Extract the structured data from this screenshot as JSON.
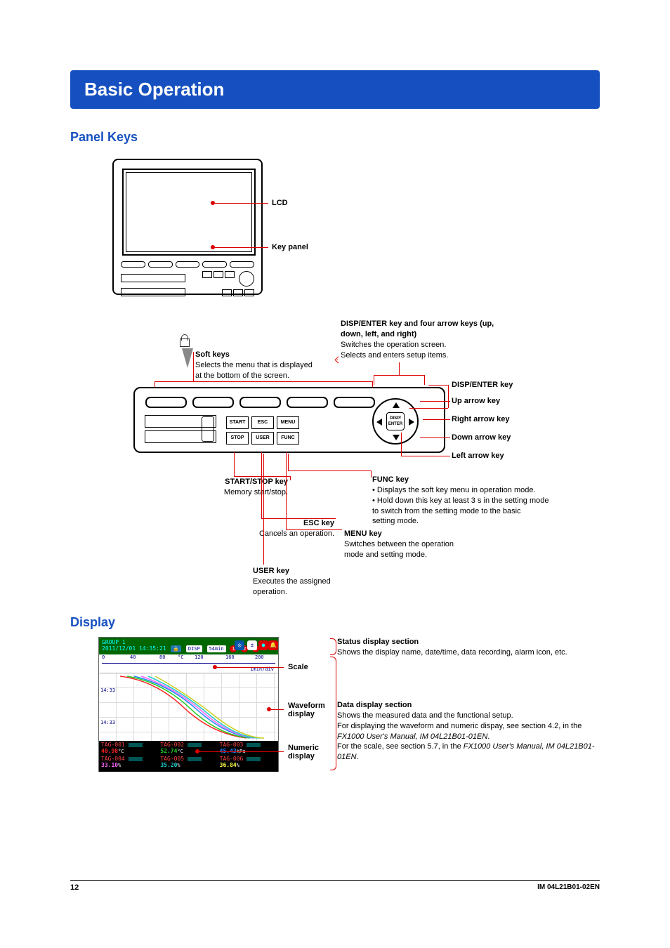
{
  "title": "Basic Operation",
  "sections": {
    "panel_keys": "Panel Keys",
    "display": "Display"
  },
  "device_labels": {
    "lcd": "LCD",
    "key_panel": "Key panel"
  },
  "softkeys": {
    "heading": "Soft keys",
    "desc1": "Selects the menu that is displayed",
    "desc2": "at the bottom of the screen."
  },
  "dpad_group": {
    "heading": "DISP/ENTER key and four arrow keys (up, down, left, and right)",
    "line1": "Switches the operation screen.",
    "line2": "Selects and enters setup items."
  },
  "key_labels": {
    "disp_enter": "DISP/ENTER key",
    "up": "Up arrow key",
    "right": "Right arrow key",
    "down": "Down arrow key",
    "left": "Left arrow key"
  },
  "buttons": {
    "start": "START",
    "esc": "ESC",
    "menu": "MENU",
    "stop": "STOP",
    "user": "USER",
    "func": "FUNC",
    "disp_enter": "DISP/\nENTER"
  },
  "callouts": {
    "start_stop": {
      "title": "START/STOP key",
      "desc": "Memory start/stop."
    },
    "esc": {
      "title": "ESC key",
      "desc": "Cancels an operation."
    },
    "menu": {
      "title": "MENU key",
      "desc1": "Switches between the operation",
      "desc2": "mode and setting mode."
    },
    "user": {
      "title": "USER key",
      "desc1": "Executes the assigned",
      "desc2": "operation."
    },
    "func": {
      "title": "FUNC key",
      "b1": "• Displays the soft key menu in operation mode.",
      "b2": "• Hold down this key at least 3 s in the setting mode",
      "b3": "  to switch from the setting mode to the basic",
      "b4": "  setting mode."
    }
  },
  "display_section": {
    "status_bar": {
      "group": "GROUP 1",
      "datetime": "2011/12/01 14:35:21",
      "disp_badge": "DISP",
      "time_badge": "54min"
    },
    "scale": {
      "s0": "0",
      "s40": "40",
      "s80": "80",
      "sc": "°C",
      "s120": "120",
      "s160": "160",
      "s200": "200",
      "unit": "1min/div"
    },
    "timestamps": {
      "t1": "14:33",
      "t2": "14:33"
    },
    "channels": [
      {
        "tag": "TAG-001",
        "val": "40.98",
        "unit": "°C",
        "color": "#f22"
      },
      {
        "tag": "TAG-002",
        "val": "52.74",
        "unit": "°C",
        "color": "#2c2"
      },
      {
        "tag": "TAG-003",
        "val": "45.43",
        "unit": "kPa",
        "color": "#28f"
      },
      {
        "tag": "TAG-004",
        "val": "33.10",
        "unit": "%",
        "color": "#f6f"
      },
      {
        "tag": "TAG-005",
        "val": "35.20",
        "unit": "%",
        "color": "#2cc"
      },
      {
        "tag": "TAG-006",
        "val": "36.84",
        "unit": "%",
        "color": "#ff4"
      }
    ],
    "screen_labels": {
      "scale": "Scale",
      "waveform": "Waveform display",
      "numeric": "Numeric display"
    },
    "desc_status": {
      "title": "Status display section",
      "text": "Shows the display name, date/time, data recording, alarm icon, etc."
    },
    "desc_data": {
      "title": "Data display section",
      "l1": "Shows the measured data and the functional setup.",
      "l2": "For displaying the waveform and numeric dispay, see section 4.2, in the ",
      "ref1": "FX1000 User's Manual, IM 04L21B01-01EN",
      "l3": "For the scale, see section 5.7, in the ",
      "ref2": "FX1000 User's Manual, IM 04L21B01-01EN"
    }
  },
  "footer": {
    "page": "12",
    "docid": "IM 04L21B01-02EN"
  }
}
